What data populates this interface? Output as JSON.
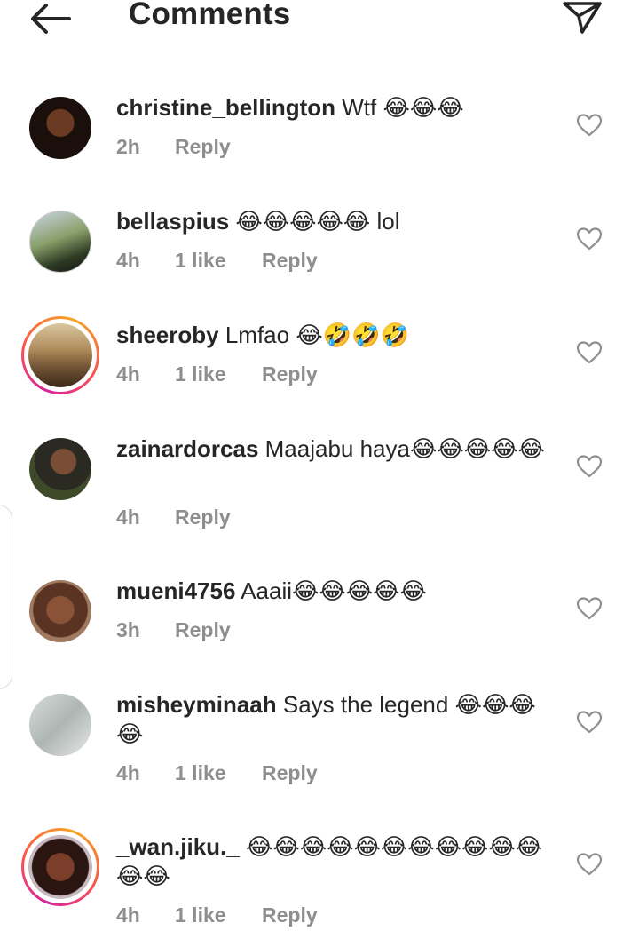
{
  "header": {
    "title": "Comments"
  },
  "comments": [
    {
      "username": "christine_bellington",
      "text": "Wtf 😂😂😂",
      "time": "2h",
      "likes": "",
      "reply": "Reply"
    },
    {
      "username": "bellaspius",
      "text": "😂😂😂😂😂 lol",
      "time": "4h",
      "likes": "1 like",
      "reply": "Reply"
    },
    {
      "username": "sheeroby",
      "text": "Lmfao 😂🤣🤣🤣",
      "time": "4h",
      "likes": "1 like",
      "reply": "Reply"
    },
    {
      "username": "zainardorcas",
      "text": "Maajabu haya😂😂😂😂😂",
      "time": "4h",
      "likes": "",
      "reply": "Reply"
    },
    {
      "username": "mueni4756",
      "text": "Aaaii😂😂😂😂😂",
      "time": "3h",
      "likes": "",
      "reply": "Reply"
    },
    {
      "username": "misheyminaah",
      "text": "Says the legend 😂😂😂😂",
      "time": "4h",
      "likes": "1 like",
      "reply": "Reply"
    },
    {
      "username": "_wan.jiku._",
      "text": "😂😂😂😂😂😂😂😂😂😂😂😂😂",
      "time": "4h",
      "likes": "1 like",
      "reply": "Reply"
    }
  ]
}
